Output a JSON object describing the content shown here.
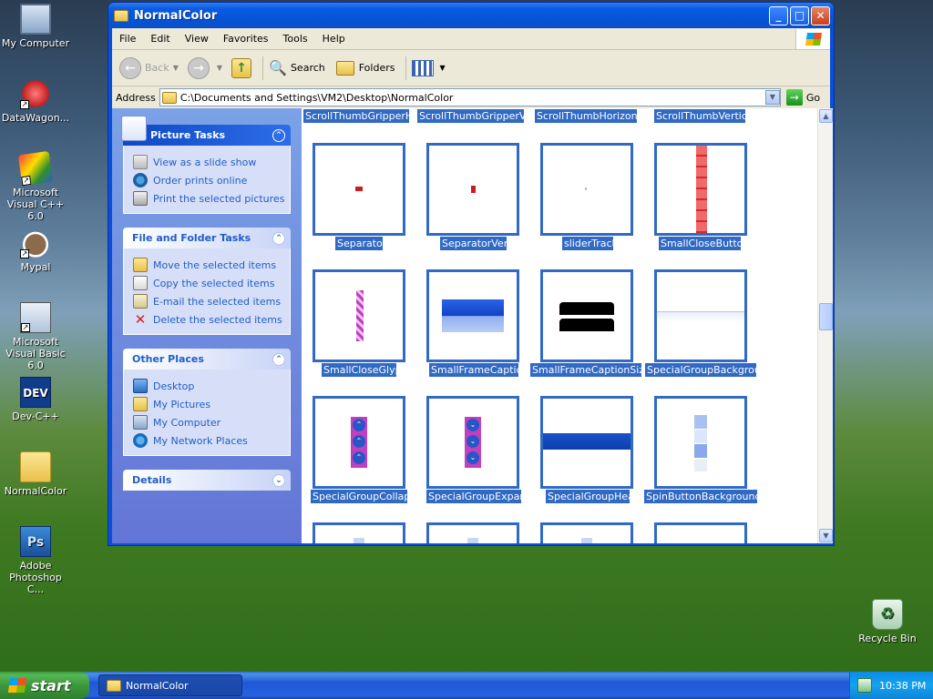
{
  "desktop": {
    "icons": [
      {
        "label": "My Computer"
      },
      {
        "label": "DataWagon..."
      },
      {
        "label": "Microsoft Visual C++ 6.0"
      },
      {
        "label": "Mypal"
      },
      {
        "label": "Microsoft Visual Basic 6.0"
      },
      {
        "label": "Dev-C++",
        "glyph": "DEV"
      },
      {
        "label": "NormalColor"
      },
      {
        "label": "Adobe Photoshop C...",
        "glyph": "Ps"
      },
      {
        "label": "Recycle Bin"
      }
    ]
  },
  "window": {
    "title": "NormalColor",
    "menu": [
      "File",
      "Edit",
      "View",
      "Favorites",
      "Tools",
      "Help"
    ],
    "toolbar": {
      "back": "Back",
      "search": "Search",
      "folders": "Folders"
    },
    "address": {
      "label": "Address",
      "path": "C:\\Documents and Settings\\VM2\\Desktop\\NormalColor",
      "go": "Go"
    }
  },
  "taskpane": {
    "picture_tasks": {
      "title": "Picture Tasks",
      "items": [
        "View as a slide show",
        "Order prints online",
        "Print the selected pictures"
      ]
    },
    "file_tasks": {
      "title": "File and Folder Tasks",
      "items": [
        "Move the selected items",
        "Copy the selected items",
        "E-mail the selected items",
        "Delete the selected items"
      ]
    },
    "other_places": {
      "title": "Other Places",
      "items": [
        "Desktop",
        "My Pictures",
        "My Computer",
        "My Network Places"
      ]
    },
    "details": {
      "title": "Details"
    }
  },
  "files": {
    "top_partial": [
      "ScrollThumbGripperH...",
      "ScrollThumbGripperVe...",
      "ScrollThumbHorizontal",
      "ScrollThumbVertical"
    ],
    "row1": [
      "Separator",
      "SeparatorVert",
      "sliderTrack",
      "SmallCloseButton"
    ],
    "row2": [
      "SmallCloseGlyph",
      "SmallFrameCaption",
      "SmallFrameCaptionSizing",
      "SpecialGroupBackground"
    ],
    "row3": [
      "SpecialGroupCollapse",
      "SpecialGroupExpand",
      "SpecialGroupHead",
      "SpinButtonBackground..."
    ]
  },
  "taskbar": {
    "start": "start",
    "button": "NormalColor",
    "clock": "10:38 PM"
  },
  "colors": {
    "selection": "#316ac5",
    "xp_blue": "#0a4fd8",
    "task_link": "#215dc6"
  }
}
